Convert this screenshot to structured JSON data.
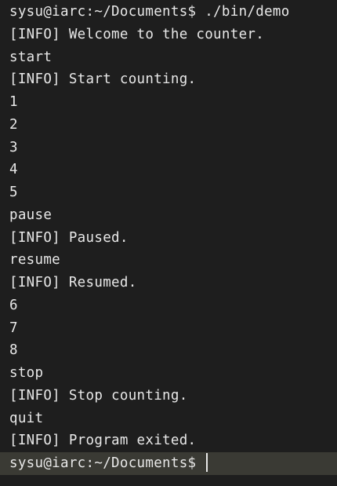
{
  "terminal": {
    "lines": [
      {
        "type": "prompt",
        "text": "sysu@iarc:~/Documents$ ./bin/demo"
      },
      {
        "type": "output",
        "text": "[INFO] Welcome to the counter."
      },
      {
        "type": "input",
        "text": "start"
      },
      {
        "type": "output",
        "text": "[INFO] Start counting."
      },
      {
        "type": "output",
        "text": "1"
      },
      {
        "type": "output",
        "text": "2"
      },
      {
        "type": "output",
        "text": "3"
      },
      {
        "type": "output",
        "text": "4"
      },
      {
        "type": "output",
        "text": "5"
      },
      {
        "type": "input",
        "text": "pause"
      },
      {
        "type": "output",
        "text": "[INFO] Paused."
      },
      {
        "type": "input",
        "text": "resume"
      },
      {
        "type": "output",
        "text": "[INFO] Resumed."
      },
      {
        "type": "output",
        "text": "6"
      },
      {
        "type": "output",
        "text": "7"
      },
      {
        "type": "output",
        "text": "8"
      },
      {
        "type": "input",
        "text": "stop"
      },
      {
        "type": "output",
        "text": "[INFO] Stop counting."
      },
      {
        "type": "input",
        "text": "quit"
      },
      {
        "type": "output",
        "text": "[INFO] Program exited."
      }
    ],
    "current_prompt": "sysu@iarc:~/Documents$",
    "colors": {
      "background": "#1e1e1e",
      "text": "#e8e8e8",
      "active_line": "#3a3a34"
    }
  }
}
